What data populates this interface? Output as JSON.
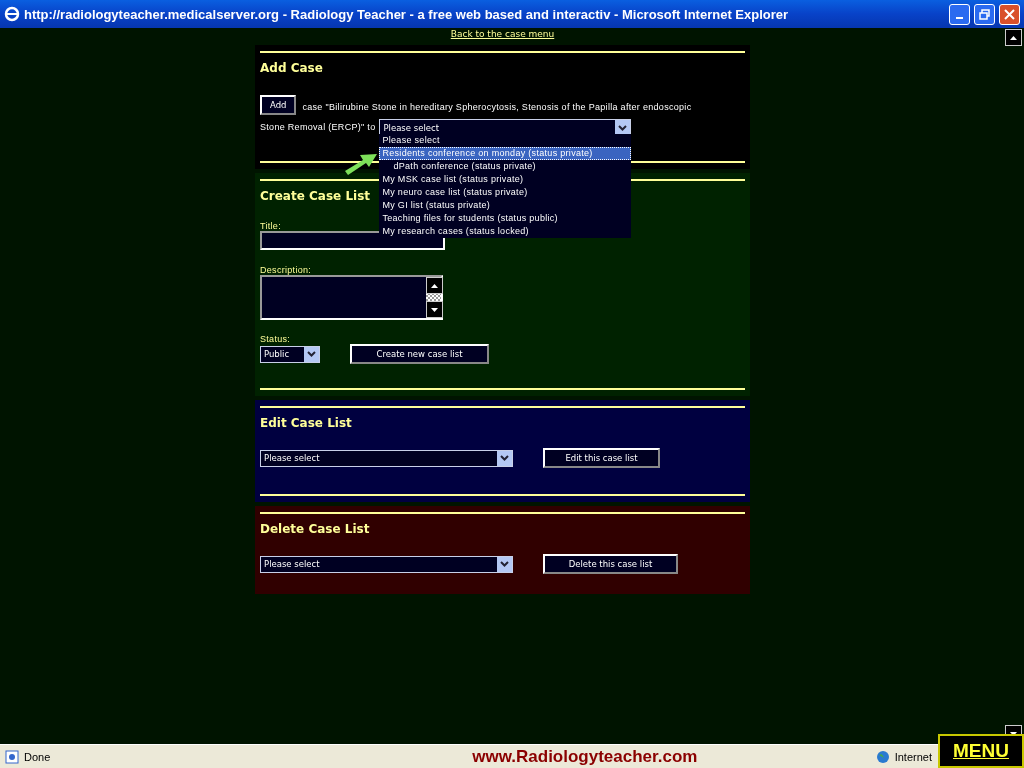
{
  "window": {
    "title": "http://radiologyteacher.medicalserver.org - Radiology Teacher - a free web based and interactiv - Microsoft Internet Explorer"
  },
  "back_link": "Back to the case menu",
  "add_case": {
    "heading": "Add Case",
    "button": "Add",
    "sentence_lines": [
      "case \"Bilirubine Stone in hereditary Spherocytosis, Stenosis of the Papilla after endoscopic",
      "Stone Removal (ERCP)\" to"
    ],
    "select": {
      "value": "Please select",
      "expanded": true,
      "options": [
        {
          "label": "Please select",
          "highlighted": false
        },
        {
          "label": "Residents conference on monday (status private)",
          "highlighted": true
        },
        {
          "label": "dPath conference (status private)",
          "highlighted": false
        },
        {
          "label": "My MSK case list (status private)",
          "highlighted": false
        },
        {
          "label": "My neuro case list (status private)",
          "highlighted": false
        },
        {
          "label": "My GI list (status private)",
          "highlighted": false
        },
        {
          "label": "Teaching files for students (status public)",
          "highlighted": false
        },
        {
          "label": "My research cases (status locked)",
          "highlighted": false
        }
      ]
    }
  },
  "create_case_list": {
    "heading": "Create Case List",
    "title_label": "Title:",
    "description_label": "Description:",
    "status_label": "Status:",
    "status_value": "Public",
    "button": "Create new case list"
  },
  "edit_case_list": {
    "heading": "Edit Case List",
    "select_value": "Please select",
    "button": "Edit this case list"
  },
  "delete_case_list": {
    "heading": "Delete Case List",
    "select_value": "Please select",
    "button": "Delete this case list"
  },
  "status_bar": {
    "status": "Done",
    "site": "www.Radiologyteacher.com",
    "zone": "Internet"
  },
  "menu_button": "MENU"
}
